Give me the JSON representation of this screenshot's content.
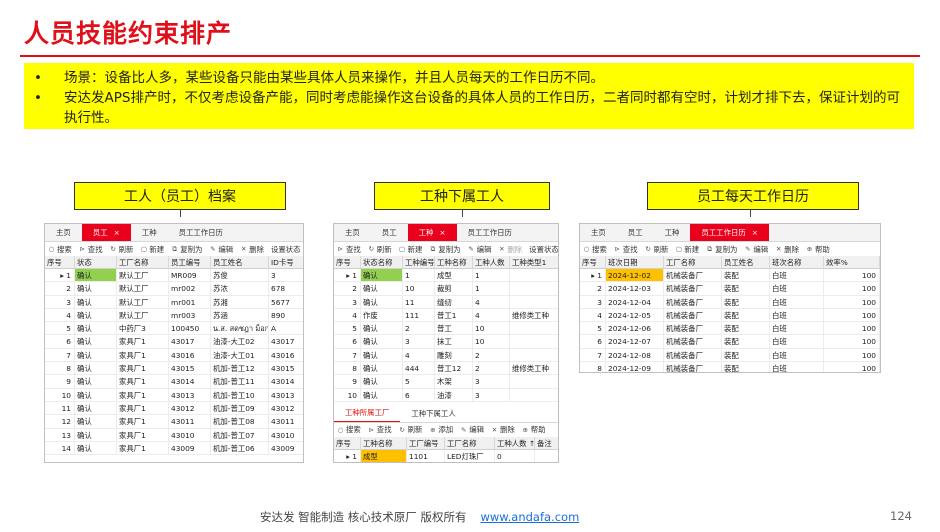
{
  "title": "人员技能约束排产",
  "bullets": [
    {
      "dot": "•",
      "text": "场景：设备比人多，某些设备只能由某些具体人员来操作，并且人员每天的工作日历不同。"
    },
    {
      "dot": "•",
      "text": "安达发APS排产时，不仅考虑设备产能，同时考虑能操作这台设备的具体人员的工作日历，二者同时都有空时，计划才排下去，保证计划的可执行性。"
    }
  ],
  "callouts": {
    "a": "工人（员工）档案",
    "b": "工种下属工人",
    "c": "员工每天工作日历"
  },
  "win1": {
    "tabs": [
      {
        "label": "主页"
      },
      {
        "label": "员工",
        "close": "×"
      },
      {
        "label": "工种"
      },
      {
        "label": "员工工作日历"
      }
    ],
    "toolbar": [
      {
        "icon": "○",
        "label": "搜索",
        "name": "search"
      },
      {
        "icon": "⊳",
        "label": "查找",
        "name": "find"
      },
      {
        "icon": "↻",
        "label": "刷新",
        "name": "refresh"
      },
      {
        "icon": "▢",
        "label": "新建",
        "name": "new"
      },
      {
        "icon": "⧉",
        "label": "复制为",
        "name": "copy-as"
      },
      {
        "icon": "✎",
        "label": "编辑",
        "name": "edit"
      },
      {
        "icon": "✕",
        "label": "删除",
        "name": "delete"
      },
      {
        "icon": "",
        "label": "设置状态 ▾",
        "name": "set-status"
      }
    ],
    "headers": [
      "序号",
      "状态",
      "工厂名称",
      "员工编号",
      "员工姓名",
      "ID卡号"
    ],
    "rows": [
      [
        "1",
        "确认",
        "默认工厂",
        "MR009",
        "苏俊",
        "3"
      ],
      [
        "2",
        "确认",
        "默认工厂",
        "mr002",
        "苏浓",
        "678"
      ],
      [
        "3",
        "确认",
        "默认工厂",
        "mr001",
        "苏湘",
        "5677"
      ],
      [
        "4",
        "确认",
        "默认工厂",
        "mr003",
        "苏涵",
        "890"
      ],
      [
        "5",
        "确认",
        "中药厂3",
        "100450",
        "น.ส. สดชฎา ม็อก...",
        "A"
      ],
      [
        "6",
        "确认",
        "家具厂1",
        "43017",
        "油漆-大工02",
        "43017"
      ],
      [
        "7",
        "确认",
        "家具厂1",
        "43016",
        "油漆-大工01",
        "43016"
      ],
      [
        "8",
        "确认",
        "家具厂1",
        "43015",
        "机加-普工12",
        "43015"
      ],
      [
        "9",
        "确认",
        "家具厂1",
        "43014",
        "机加-普工11",
        "43014"
      ],
      [
        "10",
        "确认",
        "家具厂1",
        "43013",
        "机加-普工10",
        "43013"
      ],
      [
        "11",
        "确认",
        "家具厂1",
        "43012",
        "机加-普工09",
        "43012"
      ],
      [
        "12",
        "确认",
        "家具厂1",
        "43011",
        "机加-普工08",
        "43011"
      ],
      [
        "13",
        "确认",
        "家具厂1",
        "43010",
        "机加-普工07",
        "43010"
      ],
      [
        "14",
        "确认",
        "家具厂1",
        "43009",
        "机加-普工06",
        "43009"
      ]
    ]
  },
  "win2": {
    "tabs": [
      {
        "label": "主页"
      },
      {
        "label": "员工"
      },
      {
        "label": "工种",
        "close": "×"
      },
      {
        "label": "员工工作日历"
      }
    ],
    "toolbar": [
      {
        "icon": "⊳",
        "label": "查找",
        "name": "find"
      },
      {
        "icon": "↻",
        "label": "刷新",
        "name": "refresh"
      },
      {
        "icon": "▢",
        "label": "新建",
        "name": "new"
      },
      {
        "icon": "⧉",
        "label": "复制为",
        "name": "copy-as"
      },
      {
        "icon": "✎",
        "label": "编辑",
        "name": "edit"
      },
      {
        "icon": "✕",
        "label": "删除",
        "name": "delete",
        "disabled": true
      },
      {
        "icon": "",
        "label": "设置状态 ▾",
        "name": "set-status"
      },
      {
        "icon": "⊕",
        "label": "帮",
        "name": "help"
      }
    ],
    "headers": [
      "序号",
      "状态名称",
      "工种编号",
      "工种名称",
      "工种人数",
      "工种类型1"
    ],
    "rows": [
      [
        "1",
        "确认",
        "1",
        "成型",
        "1",
        ""
      ],
      [
        "2",
        "确认",
        "10",
        "裁剪",
        "1",
        ""
      ],
      [
        "3",
        "确认",
        "11",
        "缝纫",
        "4",
        ""
      ],
      [
        "4",
        "作废",
        "111",
        "普工1",
        "4",
        "维修类工种"
      ],
      [
        "5",
        "确认",
        "2",
        "普工",
        "10",
        ""
      ],
      [
        "6",
        "确认",
        "3",
        "抹工",
        "10",
        ""
      ],
      [
        "7",
        "确认",
        "4",
        "雕刻",
        "2",
        ""
      ],
      [
        "8",
        "确认",
        "444",
        "普工12",
        "2",
        "维修类工种"
      ],
      [
        "9",
        "确认",
        "5",
        "木架",
        "3",
        ""
      ],
      [
        "10",
        "确认",
        "6",
        "油漆",
        "3",
        ""
      ]
    ],
    "subtabs": [
      {
        "label": "工种所属工厂"
      },
      {
        "label": "工种下属工人"
      }
    ],
    "subtoolbar": [
      {
        "icon": "○",
        "label": "搜索",
        "name": "search"
      },
      {
        "icon": "⊳",
        "label": "查找",
        "name": "find"
      },
      {
        "icon": "↻",
        "label": "刷新",
        "name": "refresh"
      },
      {
        "icon": "⊕",
        "label": "添加",
        "name": "add"
      },
      {
        "icon": "✎",
        "label": "编辑",
        "name": "edit"
      },
      {
        "icon": "✕",
        "label": "删除",
        "name": "delete"
      },
      {
        "icon": "⊕",
        "label": "帮助",
        "name": "help"
      }
    ],
    "subheaders": [
      "序号",
      "工种名称",
      "工厂编号",
      "工厂名称",
      "工种人数 ↑",
      "备注"
    ],
    "subrows": [
      [
        "1",
        "成型",
        "1101",
        "LED灯珠厂",
        "0",
        ""
      ],
      [
        "2",
        "成型",
        "1201",
        "化妆品厂",
        "0",
        ""
      ],
      [
        "3",
        "成型",
        "1303",
        "酒体品厂",
        "0",
        ""
      ]
    ]
  },
  "win3": {
    "tabs": [
      {
        "label": "主页"
      },
      {
        "label": "员工"
      },
      {
        "label": "工种"
      },
      {
        "label": "员工工作日历",
        "close": "×"
      }
    ],
    "toolbar": [
      {
        "icon": "○",
        "label": "搜索",
        "name": "search"
      },
      {
        "icon": "⊳",
        "label": "查找",
        "name": "find"
      },
      {
        "icon": "↻",
        "label": "刷新",
        "name": "refresh"
      },
      {
        "icon": "▢",
        "label": "新建",
        "name": "new"
      },
      {
        "icon": "⧉",
        "label": "复制为",
        "name": "copy-as"
      },
      {
        "icon": "✎",
        "label": "编辑",
        "name": "edit"
      },
      {
        "icon": "✕",
        "label": "删除",
        "name": "delete"
      },
      {
        "icon": "⊕",
        "label": "帮助",
        "name": "help"
      }
    ],
    "headers": [
      "序号",
      "班次日期",
      "工厂名称",
      "员工姓名",
      "班次名称",
      "效率%"
    ],
    "rows": [
      [
        "1",
        "2024-12-02",
        "机械装备厂",
        "装配",
        "白班",
        "100"
      ],
      [
        "2",
        "2024-12-03",
        "机械装备厂",
        "装配",
        "白班",
        "100"
      ],
      [
        "3",
        "2024-12-04",
        "机械装备厂",
        "装配",
        "白班",
        "100"
      ],
      [
        "4",
        "2024-12-05",
        "机械装备厂",
        "装配",
        "白班",
        "100"
      ],
      [
        "5",
        "2024-12-06",
        "机械装备厂",
        "装配",
        "白班",
        "100"
      ],
      [
        "6",
        "2024-12-07",
        "机械装备厂",
        "装配",
        "白班",
        "100"
      ],
      [
        "7",
        "2024-12-08",
        "机械装备厂",
        "装配",
        "白班",
        "100"
      ],
      [
        "8",
        "2024-12-09",
        "机械装备厂",
        "装配",
        "白班",
        "100"
      ],
      [
        "9",
        "2024-12-10",
        "机械装备厂",
        "装配",
        "白班",
        "100"
      ]
    ]
  },
  "footer": {
    "text": "安达发   智能制造 核心技术原厂   版权所有",
    "link": "www.andafa.com"
  },
  "page_number": "124",
  "colors": {
    "accent": "#e8001c",
    "highlight": "#ffff00",
    "status_green": "#92d050",
    "date_orange": "#ffc000"
  }
}
